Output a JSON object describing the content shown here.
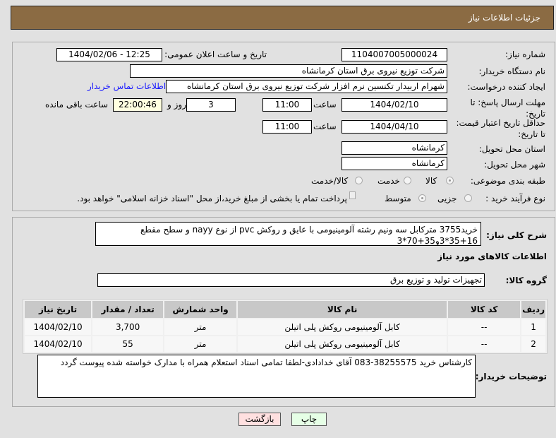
{
  "header": {
    "title": "جزئیات اطلاعات نیاز"
  },
  "form": {
    "need_number_label": "شماره نیاز:",
    "need_number": "1104007005000024",
    "announce_label": "تاریخ و ساعت اعلان عمومی:",
    "announce_value": "1404/02/06 - 12:25",
    "buyer_label": "نام دستگاه خریدار:",
    "buyer_value": "شرکت توزیع نیروی برق استان کرمانشاه",
    "creator_label": "ایجاد کننده درخواست:",
    "creator_value": "شهرام اربیدار تکنسین نرم افزار شرکت توزیع نیروی برق استان کرمانشاه",
    "contact_link": "اطلاعات تماس خریدار",
    "deadline_label": "مهلت ارسال پاسخ: تا تاریخ:",
    "deadline_date": "1404/02/10",
    "time_label": "ساعت",
    "deadline_time": "11:00",
    "days": "3",
    "days_label": "روز و",
    "remaining": "22:00:46",
    "remaining_label": "ساعت باقی مانده",
    "validity_label": "حداقل تاریخ اعتبار قیمت: تا تاریخ:",
    "validity_date": "1404/04/10",
    "validity_time": "11:00",
    "province_label": "استان محل تحویل:",
    "province": "کرمانشاه",
    "city_label": "شهر محل تحویل:",
    "city": "کرمانشاه",
    "category_label": "طبقه بندی موضوعی:",
    "category_options": [
      "کالا",
      "خدمت",
      "کالا/خدمت"
    ],
    "process_label": "نوع فرآیند خرید :",
    "process_options": [
      "جزیی",
      "متوسط"
    ],
    "payment_note": "پرداخت تمام یا بخشی از مبلغ خرید،از محل \"اسناد خزانه اسلامی\" خواهد بود."
  },
  "details": {
    "summary_label": "شرح کلی نیاز:",
    "summary": "خرید3755 مترکابل سه ونیم رشته آلومینیومی با عایق و روکش pvc از نوع nayy و سطح مقطع 16+35*3و35+70*3",
    "goods_heading": "اطلاعات کالاهای مورد نیاز",
    "group_label": "گروه کالا:",
    "group": "تجهیزات تولید و توزیع برق",
    "table": {
      "headers": [
        "ردیف",
        "کد کالا",
        "نام کالا",
        "واحد شمارش",
        "تعداد / مقدار",
        "تاریخ نیاز"
      ],
      "rows": [
        [
          "1",
          "--",
          "کابل آلومینیومی روکش پلی اتیلن",
          "متر",
          "3,700",
          "1404/02/10"
        ],
        [
          "2",
          "--",
          "کابل آلومینیومی روکش پلی اتیلن",
          "متر",
          "55",
          "1404/02/10"
        ]
      ]
    },
    "notes_label": "توضیحات خریدار:",
    "notes": "کارشناس خرید 38255575-083 آقای خدادادی-لطفا تمامی اسناد استعلام همراه با مدارک خواسته شده پیوست گردد"
  },
  "buttons": {
    "print": "چاپ",
    "back": "بازگشت"
  }
}
